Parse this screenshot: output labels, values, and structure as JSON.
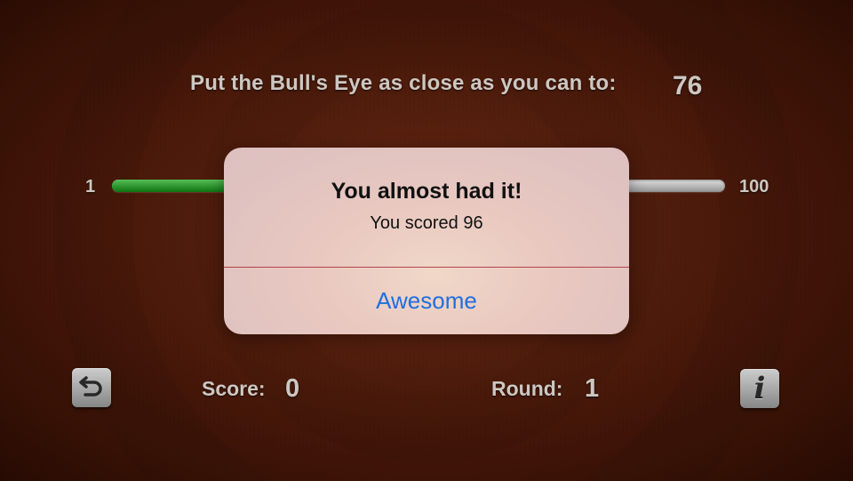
{
  "game": {
    "instruction": "Put the Bull's Eye as close as you can to:",
    "target_value": "76"
  },
  "slider": {
    "min_label": "1",
    "max_label": "100",
    "value_fraction": 0.5
  },
  "footer": {
    "restart_icon": "restart-icon",
    "info_icon": "info-icon",
    "info_glyph": "i",
    "score_label": "Score:",
    "score_value": "0",
    "round_label": "Round:",
    "round_value": "1"
  },
  "alert": {
    "title": "You almost had it!",
    "message": "You scored 96",
    "button_label": "Awesome"
  },
  "colors": {
    "background": "#521d0c",
    "slider_fill": "#1f8f22",
    "alert_button": "#1f6fe0"
  }
}
